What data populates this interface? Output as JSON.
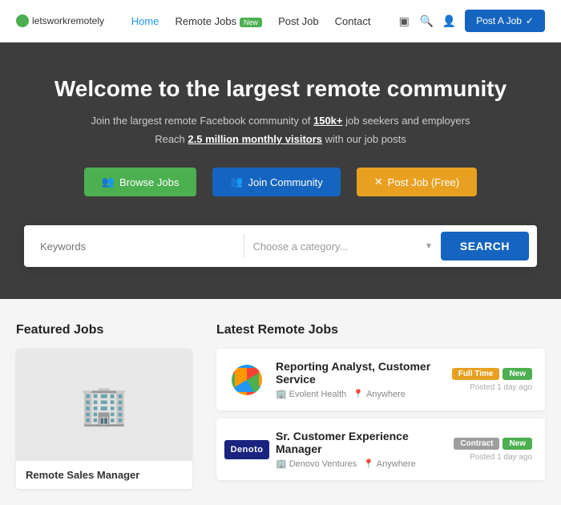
{
  "logo": {
    "text": "letsworkremotely"
  },
  "nav": {
    "links": [
      {
        "label": "Home",
        "active": true
      },
      {
        "label": "Remote Jobs",
        "badge": "New"
      },
      {
        "label": "Post Job"
      },
      {
        "label": "Contact"
      }
    ],
    "post_job_button": "Post A Job"
  },
  "hero": {
    "title": "Welcome to the largest remote community",
    "subtitle1_before": "Join the largest remote Facebook community of ",
    "subtitle1_link": "150k+",
    "subtitle1_after": " job seekers and employers",
    "subtitle2_before": "Reach ",
    "subtitle2_link": "2.5 million monthly visitors",
    "subtitle2_after": " with our job posts",
    "buttons": {
      "browse": "Browse Jobs",
      "join": "Join Community",
      "post": "Post Job (Free)"
    }
  },
  "search": {
    "keywords_placeholder": "Keywords",
    "category_placeholder": "Choose a category...",
    "button_label": "SEARCH"
  },
  "featured": {
    "title": "Featured Jobs",
    "job": {
      "title": "Remote Sales Manager"
    }
  },
  "latest": {
    "title": "Latest Remote Jobs",
    "jobs": [
      {
        "id": 1,
        "title": "Reporting Analyst, Customer Service",
        "company": "Evolent Health",
        "location": "Anywhere",
        "logo_type": "ring",
        "badges": [
          "Full Time",
          "New"
        ],
        "posted": "Posted 1 day ago"
      },
      {
        "id": 2,
        "title": "Sr. Customer Experience Manager",
        "company": "Denovo Ventures",
        "location": "Anywhere",
        "logo_type": "denovo",
        "badges": [
          "Contract",
          "New"
        ],
        "posted": "Posted 1 day ago"
      }
    ]
  }
}
